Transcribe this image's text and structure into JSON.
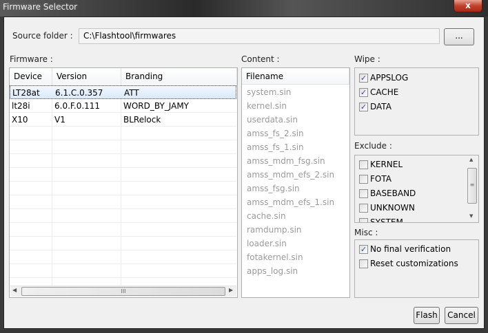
{
  "window": {
    "title": "Firmware Selector",
    "close": "x"
  },
  "source": {
    "label": "Source folder :",
    "value": "C:\\Flashtool\\firmwares",
    "browse": "..."
  },
  "firmware": {
    "label": "Firmware :",
    "columns": [
      "Device",
      "Version",
      "Branding"
    ],
    "rows": [
      [
        "LT28at",
        "6.1.C.0.357",
        "ATT"
      ],
      [
        "lt28i",
        "6.0.F.0.111",
        "WORD_BY_JAMY"
      ],
      [
        "X10",
        "V1",
        "BLRelock"
      ]
    ],
    "scroll_grip": "III"
  },
  "content": {
    "label": "Content :",
    "header": "Filename",
    "files": [
      "system.sin",
      "kernel.sin",
      "userdata.sin",
      "amss_fs_2.sin",
      "amss_fs_1.sin",
      "amss_mdm_fsg.sin",
      "amss_mdm_efs_2.sin",
      "amss_fsg.sin",
      "amss_mdm_efs_1.sin",
      "cache.sin",
      "ramdump.sin",
      "loader.sin",
      "fotakernel.sin",
      "apps_log.sin"
    ]
  },
  "wipe": {
    "label": "Wipe :",
    "items": [
      {
        "label": "APPSLOG",
        "checked": true
      },
      {
        "label": "CACHE",
        "checked": true
      },
      {
        "label": "DATA",
        "checked": true
      }
    ]
  },
  "exclude": {
    "label": "Exclude :",
    "items": [
      {
        "label": "KERNEL",
        "checked": false
      },
      {
        "label": "FOTA",
        "checked": false
      },
      {
        "label": "BASEBAND",
        "checked": false
      },
      {
        "label": "UNKNOWN",
        "checked": false
      },
      {
        "label": "SYSTEM",
        "checked": false
      }
    ]
  },
  "misc": {
    "label": "Misc :",
    "items": [
      {
        "label": "No final verification",
        "checked": true
      },
      {
        "label": "Reset customizations",
        "checked": false
      }
    ]
  },
  "buttons": {
    "flash": "Flash",
    "cancel": "Cancel"
  }
}
